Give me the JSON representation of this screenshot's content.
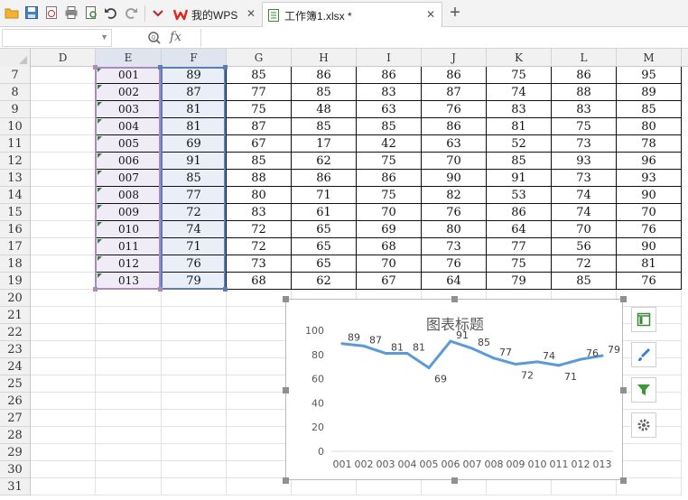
{
  "toolbar": {
    "quick_access": [
      "open-icon",
      "save-icon",
      "export-pdf-icon",
      "print-icon",
      "print-preview-icon",
      "undo-icon",
      "redo-icon",
      "customize-icon"
    ]
  },
  "tabs": [
    {
      "label": "我的WPS",
      "active": false
    },
    {
      "label": "工作簿1.xlsx *",
      "active": true
    }
  ],
  "formula_bar": {
    "name_box": "",
    "fx_label": "fx",
    "formula": ""
  },
  "columns": [
    "D",
    "E",
    "F",
    "G",
    "H",
    "I",
    "J",
    "K",
    "L",
    "M"
  ],
  "rows": [
    {
      "num": "7",
      "cells": [
        "",
        "001",
        "89",
        "85",
        "86",
        "86",
        "86",
        "75",
        "86",
        "95"
      ]
    },
    {
      "num": "8",
      "cells": [
        "",
        "002",
        "87",
        "77",
        "85",
        "83",
        "87",
        "74",
        "88",
        "89"
      ]
    },
    {
      "num": "9",
      "cells": [
        "",
        "003",
        "81",
        "75",
        "48",
        "63",
        "76",
        "83",
        "83",
        "85"
      ]
    },
    {
      "num": "10",
      "cells": [
        "",
        "004",
        "81",
        "87",
        "85",
        "85",
        "86",
        "81",
        "75",
        "80"
      ]
    },
    {
      "num": "11",
      "cells": [
        "",
        "005",
        "69",
        "67",
        "17",
        "42",
        "63",
        "52",
        "73",
        "78"
      ]
    },
    {
      "num": "12",
      "cells": [
        "",
        "006",
        "91",
        "85",
        "62",
        "75",
        "70",
        "85",
        "93",
        "96"
      ]
    },
    {
      "num": "13",
      "cells": [
        "",
        "007",
        "85",
        "88",
        "86",
        "86",
        "90",
        "91",
        "73",
        "93"
      ]
    },
    {
      "num": "14",
      "cells": [
        "",
        "008",
        "77",
        "80",
        "71",
        "75",
        "82",
        "53",
        "74",
        "90"
      ]
    },
    {
      "num": "15",
      "cells": [
        "",
        "009",
        "72",
        "83",
        "61",
        "70",
        "76",
        "86",
        "74",
        "70"
      ]
    },
    {
      "num": "16",
      "cells": [
        "",
        "010",
        "74",
        "72",
        "65",
        "69",
        "80",
        "64",
        "70",
        "76"
      ]
    },
    {
      "num": "17",
      "cells": [
        "",
        "011",
        "71",
        "72",
        "65",
        "68",
        "73",
        "77",
        "56",
        "90"
      ]
    },
    {
      "num": "18",
      "cells": [
        "",
        "012",
        "76",
        "73",
        "65",
        "70",
        "76",
        "75",
        "72",
        "81"
      ]
    },
    {
      "num": "19",
      "cells": [
        "",
        "013",
        "79",
        "68",
        "62",
        "67",
        "64",
        "79",
        "85",
        "76"
      ]
    },
    {
      "num": "20",
      "cells": [
        "",
        "",
        "",
        "",
        "",
        "",
        "",
        "",
        "",
        ""
      ]
    },
    {
      "num": "21",
      "cells": [
        "",
        "",
        "",
        "",
        "",
        "",
        "",
        "",
        "",
        ""
      ]
    },
    {
      "num": "22",
      "cells": [
        "",
        "",
        "",
        "",
        "",
        "",
        "",
        "",
        "",
        ""
      ]
    },
    {
      "num": "23",
      "cells": [
        "",
        "",
        "",
        "",
        "",
        "",
        "",
        "",
        "",
        ""
      ]
    },
    {
      "num": "24",
      "cells": [
        "",
        "",
        "",
        "",
        "",
        "",
        "",
        "",
        "",
        ""
      ]
    },
    {
      "num": "25",
      "cells": [
        "",
        "",
        "",
        "",
        "",
        "",
        "",
        "",
        "",
        ""
      ]
    },
    {
      "num": "26",
      "cells": [
        "",
        "",
        "",
        "",
        "",
        "",
        "",
        "",
        "",
        ""
      ]
    },
    {
      "num": "27",
      "cells": [
        "",
        "",
        "",
        "",
        "",
        "",
        "",
        "",
        "",
        ""
      ]
    },
    {
      "num": "28",
      "cells": [
        "",
        "",
        "",
        "",
        "",
        "",
        "",
        "",
        "",
        ""
      ]
    },
    {
      "num": "29",
      "cells": [
        "",
        "",
        "",
        "",
        "",
        "",
        "",
        "",
        "",
        ""
      ]
    },
    {
      "num": "30",
      "cells": [
        "",
        "",
        "",
        "",
        "",
        "",
        "",
        "",
        "",
        ""
      ]
    },
    {
      "num": "31",
      "cells": [
        "",
        "",
        "",
        "",
        "",
        "",
        "",
        "",
        "",
        ""
      ]
    }
  ],
  "chart_data": {
    "type": "line",
    "title": "图表标题",
    "categories": [
      "001",
      "002",
      "003",
      "004",
      "005",
      "006",
      "007",
      "008",
      "009",
      "010",
      "011",
      "012",
      "013"
    ],
    "values": [
      89,
      87,
      81,
      81,
      69,
      91,
      85,
      77,
      72,
      74,
      71,
      76,
      79
    ],
    "ylim": [
      0,
      100
    ],
    "yticks": [
      0,
      20,
      40,
      60,
      80,
      100
    ],
    "line_color": "#5b9bd5",
    "data_labels": true,
    "grid": false,
    "legend": "none"
  },
  "chart_tools": [
    "chart-elements-icon",
    "chart-style-icon",
    "chart-filter-icon",
    "chart-settings-icon"
  ],
  "colors": {
    "tab_accent": "#e2241a",
    "selection_e": "#a98bbd",
    "selection_f": "#5a7fb6"
  }
}
